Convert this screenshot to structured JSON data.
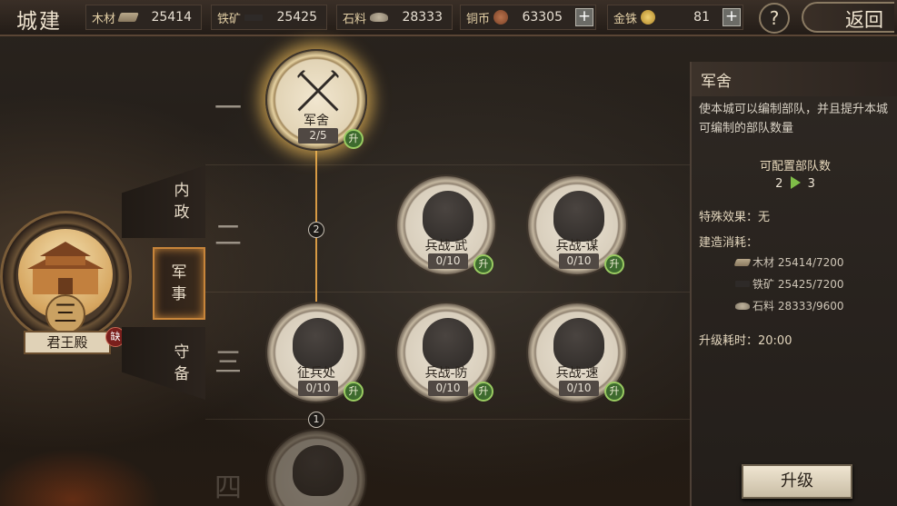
{
  "header": {
    "title": "城建",
    "help": "?",
    "back": "返回"
  },
  "resources": [
    {
      "name": "木材",
      "value": "25414",
      "icon": "wood-icon"
    },
    {
      "name": "铁矿",
      "value": "25425",
      "icon": "iron-icon"
    },
    {
      "name": "石料",
      "value": "28333",
      "icon": "stone-icon"
    },
    {
      "name": "铜币",
      "value": "63305",
      "icon": "copper-coin-icon"
    },
    {
      "name": "金铢",
      "value": "81",
      "icon": "gold-coin-icon"
    }
  ],
  "hall": {
    "level": "三",
    "name": "君王殿",
    "badge": "缺"
  },
  "tabs": [
    {
      "label": "内政",
      "l1": "内",
      "l2": "政"
    },
    {
      "label": "军事",
      "l1": "军",
      "l2": "事"
    },
    {
      "label": "守备",
      "l1": "守",
      "l2": "备"
    }
  ],
  "tiers": [
    "一",
    "二",
    "三",
    "四"
  ],
  "nodes": [
    {
      "name": "军舍",
      "level": "2/5",
      "up": "升"
    },
    {
      "name": "兵战-武",
      "level": "0/10",
      "up": "升"
    },
    {
      "name": "兵战-谋",
      "level": "0/10",
      "up": "升"
    },
    {
      "name": "征兵处",
      "level": "0/10",
      "up": "升"
    },
    {
      "name": "兵战-防",
      "level": "0/10",
      "up": "升"
    },
    {
      "name": "兵战-速",
      "level": "0/10",
      "up": "升"
    }
  ],
  "links": [
    "2",
    "1"
  ],
  "info": {
    "title": "军舍",
    "desc": "使本城可以编制部队，并且提升本城可编制的部队数量",
    "cfg_label": "可配置部队数",
    "cfg_from": "2",
    "cfg_to": "3",
    "effect": "特殊效果：无",
    "cost_label": "建造消耗：",
    "costs": [
      "木材 25414/7200",
      "铁矿 25425/7200",
      "石料 28333/9600"
    ],
    "time": "升级耗时：20:00",
    "upgrade": "升级"
  },
  "colors": {
    "accent": "#d79a44",
    "upgrade_badge": "#3d6a2e",
    "selected_glow": "#f0be5a"
  }
}
